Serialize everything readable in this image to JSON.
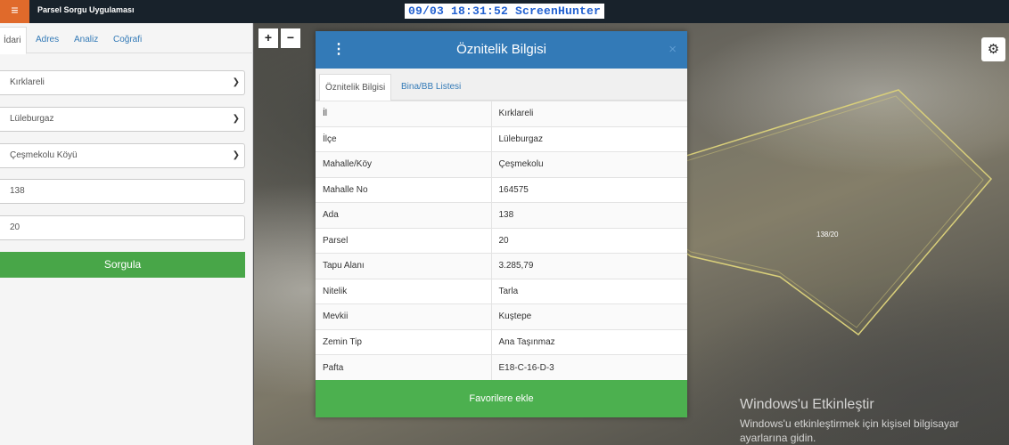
{
  "app": {
    "title": "Parsel Sorgu Uygulaması",
    "menu_icon": "hamburger-icon"
  },
  "screenhunter": {
    "text": "09/03  18:31:52  ScreenHunter"
  },
  "sidebar": {
    "tabs": [
      {
        "label": "İdari",
        "active": true
      },
      {
        "label": "Adres"
      },
      {
        "label": "Analiz"
      },
      {
        "label": "Coğrafi"
      }
    ],
    "il_select": "Kırklareli",
    "ilce_select": "Lüleburgaz",
    "mahalle_select": "Çeşmekolu Köyü",
    "ada_input": "138",
    "parsel_input": "20",
    "query_button": "Sorgula"
  },
  "map": {
    "zoom_in": "+",
    "zoom_out": "−",
    "parcel_label": "138/20",
    "settings_icon": "gear-icon"
  },
  "modal": {
    "title": "Öznitelik Bilgisi",
    "close": "×",
    "tabs": [
      {
        "label": "Öznitelik Bilgisi",
        "active": true
      },
      {
        "label": "Bina/BB Listesi"
      }
    ],
    "rows": [
      {
        "key": "İl",
        "value": "Kırklareli"
      },
      {
        "key": "İlçe",
        "value": "Lüleburgaz"
      },
      {
        "key": "Mahalle/Köy",
        "value": "Çeşmekolu"
      },
      {
        "key": "Mahalle No",
        "value": "164575"
      },
      {
        "key": "Ada",
        "value": "138"
      },
      {
        "key": "Parsel",
        "value": "20"
      },
      {
        "key": "Tapu Alanı",
        "value": "3.285,79"
      },
      {
        "key": "Nitelik",
        "value": "Tarla"
      },
      {
        "key": "Mevkii",
        "value": "Kuştepe"
      },
      {
        "key": "Zemin Tip",
        "value": "Ana Taşınmaz"
      },
      {
        "key": "Pafta",
        "value": "E18-C-16-D-3"
      }
    ],
    "favorite_button": "Favorilere ekle"
  },
  "windows_watermark": {
    "title": "Windows'u Etkinleştir",
    "subtitle": "Windows'u etkinleştirmek için kişisel bilgisayar ayarlarına gidin."
  },
  "colors": {
    "topbar": "#18222b",
    "menu_button": "#e06a2b",
    "modal_header": "#337ab7",
    "query_button": "#48a648",
    "favorite_button": "#4cb04f",
    "parcel_outline": "#d9cf7a"
  }
}
